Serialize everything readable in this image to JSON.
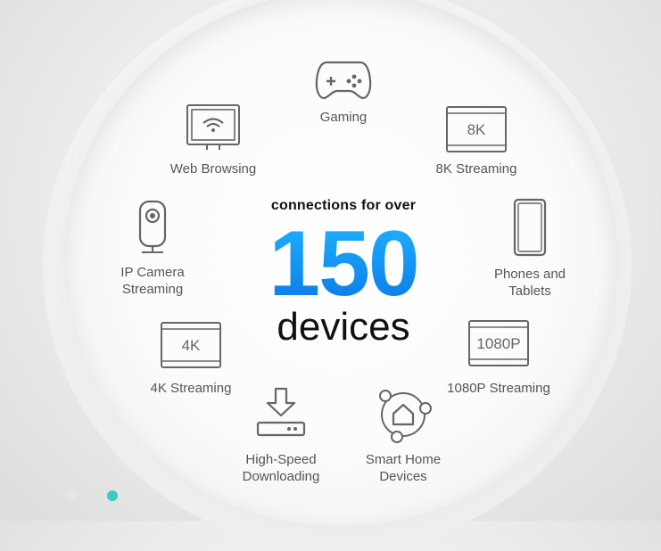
{
  "headline": {
    "tagline": "connections for over",
    "number": "150",
    "unit": "devices"
  },
  "features": [
    {
      "icon": "gamepad-icon",
      "label": "Gaming"
    },
    {
      "icon": "monitor-wifi-icon",
      "label": "Web Browsing"
    },
    {
      "icon": "screen-8k-icon",
      "label": "8K Streaming",
      "badge": "8K"
    },
    {
      "icon": "ip-camera-icon",
      "label_line1": "IP Camera",
      "label_line2": "Streaming"
    },
    {
      "icon": "smartphone-icon",
      "label_line1": "Phones and",
      "label_line2": "Tablets"
    },
    {
      "icon": "screen-4k-icon",
      "label": "4K Streaming",
      "badge": "4K"
    },
    {
      "icon": "screen-1080p-icon",
      "label": "1080P Streaming",
      "badge": "1080P"
    },
    {
      "icon": "download-router-icon",
      "label_line1": "High-Speed",
      "label_line2": "Downloading"
    },
    {
      "icon": "smart-home-icon",
      "label_line1": "Smart Home",
      "label_line2": "Devices"
    }
  ],
  "carousel": {
    "active_color": "#3ec8c0",
    "inactive_color": "#e6e6e6"
  }
}
